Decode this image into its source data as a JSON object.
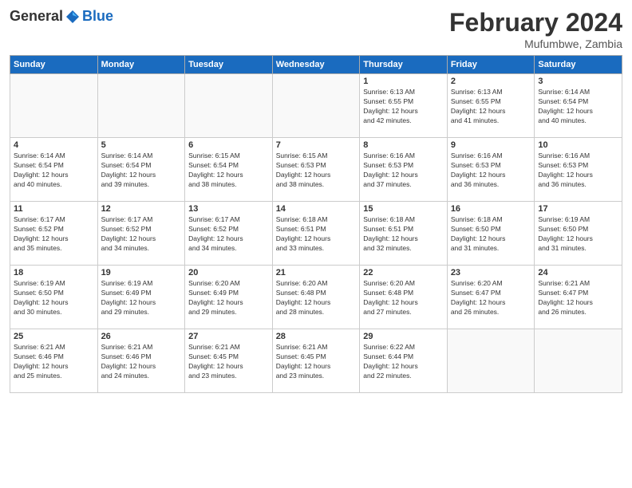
{
  "header": {
    "logo_general": "General",
    "logo_blue": "Blue",
    "month_title": "February 2024",
    "location": "Mufumbwe, Zambia"
  },
  "days_of_week": [
    "Sunday",
    "Monday",
    "Tuesday",
    "Wednesday",
    "Thursday",
    "Friday",
    "Saturday"
  ],
  "weeks": [
    [
      {
        "day": "",
        "info": ""
      },
      {
        "day": "",
        "info": ""
      },
      {
        "day": "",
        "info": ""
      },
      {
        "day": "",
        "info": ""
      },
      {
        "day": "1",
        "info": "Sunrise: 6:13 AM\nSunset: 6:55 PM\nDaylight: 12 hours\nand 42 minutes."
      },
      {
        "day": "2",
        "info": "Sunrise: 6:13 AM\nSunset: 6:55 PM\nDaylight: 12 hours\nand 41 minutes."
      },
      {
        "day": "3",
        "info": "Sunrise: 6:14 AM\nSunset: 6:54 PM\nDaylight: 12 hours\nand 40 minutes."
      }
    ],
    [
      {
        "day": "4",
        "info": "Sunrise: 6:14 AM\nSunset: 6:54 PM\nDaylight: 12 hours\nand 40 minutes."
      },
      {
        "day": "5",
        "info": "Sunrise: 6:14 AM\nSunset: 6:54 PM\nDaylight: 12 hours\nand 39 minutes."
      },
      {
        "day": "6",
        "info": "Sunrise: 6:15 AM\nSunset: 6:54 PM\nDaylight: 12 hours\nand 38 minutes."
      },
      {
        "day": "7",
        "info": "Sunrise: 6:15 AM\nSunset: 6:53 PM\nDaylight: 12 hours\nand 38 minutes."
      },
      {
        "day": "8",
        "info": "Sunrise: 6:16 AM\nSunset: 6:53 PM\nDaylight: 12 hours\nand 37 minutes."
      },
      {
        "day": "9",
        "info": "Sunrise: 6:16 AM\nSunset: 6:53 PM\nDaylight: 12 hours\nand 36 minutes."
      },
      {
        "day": "10",
        "info": "Sunrise: 6:16 AM\nSunset: 6:53 PM\nDaylight: 12 hours\nand 36 minutes."
      }
    ],
    [
      {
        "day": "11",
        "info": "Sunrise: 6:17 AM\nSunset: 6:52 PM\nDaylight: 12 hours\nand 35 minutes."
      },
      {
        "day": "12",
        "info": "Sunrise: 6:17 AM\nSunset: 6:52 PM\nDaylight: 12 hours\nand 34 minutes."
      },
      {
        "day": "13",
        "info": "Sunrise: 6:17 AM\nSunset: 6:52 PM\nDaylight: 12 hours\nand 34 minutes."
      },
      {
        "day": "14",
        "info": "Sunrise: 6:18 AM\nSunset: 6:51 PM\nDaylight: 12 hours\nand 33 minutes."
      },
      {
        "day": "15",
        "info": "Sunrise: 6:18 AM\nSunset: 6:51 PM\nDaylight: 12 hours\nand 32 minutes."
      },
      {
        "day": "16",
        "info": "Sunrise: 6:18 AM\nSunset: 6:50 PM\nDaylight: 12 hours\nand 31 minutes."
      },
      {
        "day": "17",
        "info": "Sunrise: 6:19 AM\nSunset: 6:50 PM\nDaylight: 12 hours\nand 31 minutes."
      }
    ],
    [
      {
        "day": "18",
        "info": "Sunrise: 6:19 AM\nSunset: 6:50 PM\nDaylight: 12 hours\nand 30 minutes."
      },
      {
        "day": "19",
        "info": "Sunrise: 6:19 AM\nSunset: 6:49 PM\nDaylight: 12 hours\nand 29 minutes."
      },
      {
        "day": "20",
        "info": "Sunrise: 6:20 AM\nSunset: 6:49 PM\nDaylight: 12 hours\nand 29 minutes."
      },
      {
        "day": "21",
        "info": "Sunrise: 6:20 AM\nSunset: 6:48 PM\nDaylight: 12 hours\nand 28 minutes."
      },
      {
        "day": "22",
        "info": "Sunrise: 6:20 AM\nSunset: 6:48 PM\nDaylight: 12 hours\nand 27 minutes."
      },
      {
        "day": "23",
        "info": "Sunrise: 6:20 AM\nSunset: 6:47 PM\nDaylight: 12 hours\nand 26 minutes."
      },
      {
        "day": "24",
        "info": "Sunrise: 6:21 AM\nSunset: 6:47 PM\nDaylight: 12 hours\nand 26 minutes."
      }
    ],
    [
      {
        "day": "25",
        "info": "Sunrise: 6:21 AM\nSunset: 6:46 PM\nDaylight: 12 hours\nand 25 minutes."
      },
      {
        "day": "26",
        "info": "Sunrise: 6:21 AM\nSunset: 6:46 PM\nDaylight: 12 hours\nand 24 minutes."
      },
      {
        "day": "27",
        "info": "Sunrise: 6:21 AM\nSunset: 6:45 PM\nDaylight: 12 hours\nand 23 minutes."
      },
      {
        "day": "28",
        "info": "Sunrise: 6:21 AM\nSunset: 6:45 PM\nDaylight: 12 hours\nand 23 minutes."
      },
      {
        "day": "29",
        "info": "Sunrise: 6:22 AM\nSunset: 6:44 PM\nDaylight: 12 hours\nand 22 minutes."
      },
      {
        "day": "",
        "info": ""
      },
      {
        "day": "",
        "info": ""
      }
    ]
  ]
}
